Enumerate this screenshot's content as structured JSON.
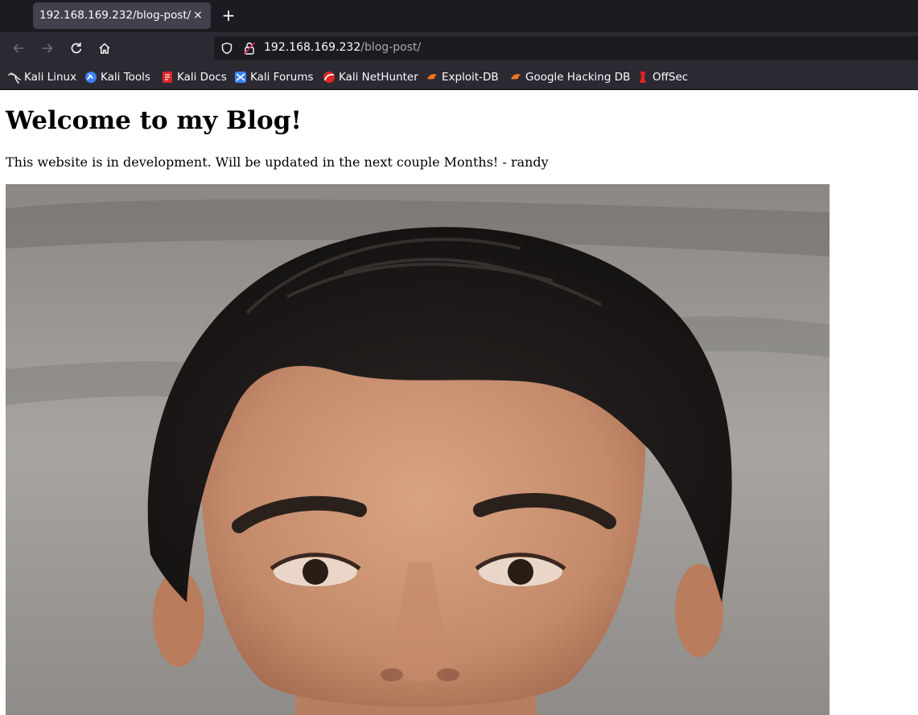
{
  "browser": {
    "tab": {
      "title": "192.168.169.232/blog-post/",
      "close": "×"
    },
    "new_tab": "+",
    "url": {
      "host": "192.168.169.232",
      "path": "/blog-post/"
    },
    "bookmarks": [
      {
        "label": "Kali Linux",
        "icon": "kali-dragon-icon",
        "color": "#e6e6e6"
      },
      {
        "label": "Kali Tools",
        "icon": "kali-tools-icon",
        "color": "#3b82f6"
      },
      {
        "label": "Kali Docs",
        "icon": "kali-docs-icon",
        "color": "#dc2626"
      },
      {
        "label": "Kali Forums",
        "icon": "kali-forums-icon",
        "color": "#3b82f6"
      },
      {
        "label": "Kali NetHunter",
        "icon": "nethunter-icon",
        "color": "#dc2626"
      },
      {
        "label": "Exploit-DB",
        "icon": "exploit-db-icon",
        "color": "#f97316"
      },
      {
        "label": "Google Hacking DB",
        "icon": "ghdb-icon",
        "color": "#f97316"
      },
      {
        "label": "OffSec",
        "icon": "offsec-icon",
        "color": "#dc2626"
      }
    ]
  },
  "page": {
    "heading": "Welcome to my Blog!",
    "text": "This website is in development. Will be updated in the next couple Months! - randy"
  }
}
